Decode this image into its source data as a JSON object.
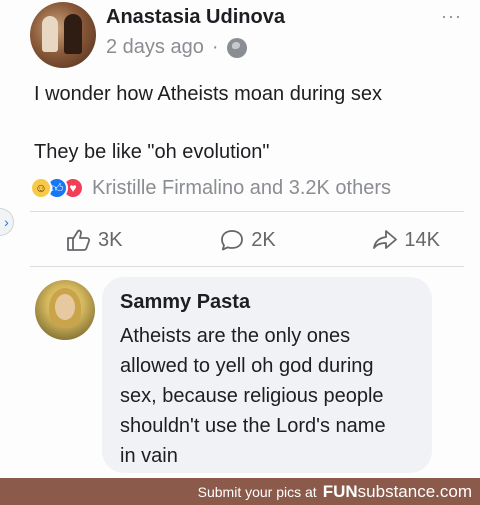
{
  "post": {
    "author": "Anastasia Udinova",
    "time": "2 days ago",
    "separator": "·",
    "more": "···",
    "text_line1": "I wonder how Atheists moan during sex",
    "text_line2": "They be like \"oh evolution\"",
    "reactions_text": "Kristille Firmalino and 3.2K others",
    "reaction_icons": [
      "haha-icon",
      "like-icon",
      "love-icon"
    ],
    "actions": {
      "like_count": "3K",
      "comment_count": "2K",
      "share_count": "14K"
    }
  },
  "comment": {
    "name": "Sammy Pasta",
    "text": "Atheists are the only ones\nallowed to yell oh god during\nsex, because religious people\nshouldn't use the Lord's name\nin vain"
  },
  "footer": {
    "text": "Submit your pics at",
    "brand_prefix": "FUN",
    "brand_suffix": "substance.com"
  },
  "colors": {
    "accent": "#1877f2",
    "muted": "#8a8d91",
    "footer_bg": "#8b5a4a"
  }
}
